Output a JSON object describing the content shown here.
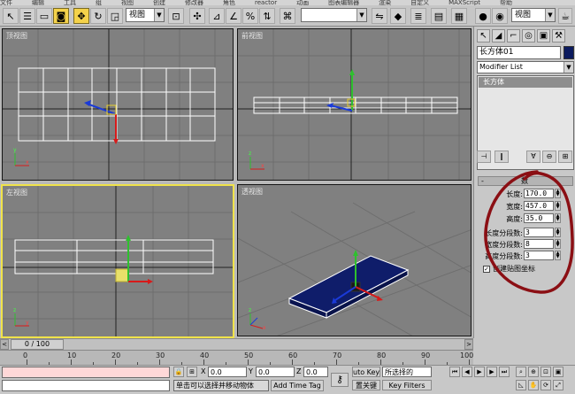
{
  "menu": [
    "文件",
    "编辑",
    "工具",
    "组",
    "视图",
    "创建",
    "修改器",
    "角色",
    "reactor",
    "动画",
    "图表编辑器",
    "渲染",
    "自定义",
    "MAXScript",
    "帮助"
  ],
  "toolbar": {
    "refcoord_value": "视图",
    "named_selection_value": "",
    "view_combo_value": "视图"
  },
  "viewports": {
    "top": {
      "label": "顶视图"
    },
    "front": {
      "label": "前视图"
    },
    "left": {
      "label": "左视图"
    },
    "perspective": {
      "label": "透视图"
    }
  },
  "axis_labels": {
    "x": "x",
    "y": "y",
    "z": "z"
  },
  "command_panel": {
    "object_name": "长方体01",
    "object_color": "#0b1a5e",
    "modifier_list": "Modifier List",
    "stack_item": "长方体",
    "params_title": "数",
    "params": [
      {
        "label": "长度:",
        "value": "170.0"
      },
      {
        "label": "宽度:",
        "value": "457.0"
      },
      {
        "label": "高度:",
        "value": "35.0"
      },
      {
        "label": "长度分段数:",
        "value": "3"
      },
      {
        "label": "宽度分段数:",
        "value": "8"
      },
      {
        "label": "高度分段数:",
        "value": "3"
      }
    ],
    "gen_mapping_label": "创建贴图坐标",
    "gen_mapping_checked": "✓"
  },
  "timeline": {
    "frame_display": "0 / 100",
    "ticks": [
      "0",
      "10",
      "20",
      "30",
      "40",
      "50",
      "60",
      "70",
      "80",
      "90",
      "100"
    ]
  },
  "status": {
    "x_label": "X",
    "x_value": "0.0",
    "y_label": "Y",
    "y_value": "0.0",
    "z_label": "Z",
    "z_value": "0.0",
    "auto_key": "uto Key",
    "selection_filter": "所选择的",
    "set_key": "置关键",
    "key_filters": "Key Filters",
    "prompt": "单击可以选择并移动物体",
    "add_time_tag": "Add Time Tag"
  },
  "colors": {
    "viewport_bg": "#808080",
    "active_border": "#f0e34a",
    "box_fill": "#0f1d6a",
    "wire": "#ffffff",
    "annotation": "#8b0f14"
  }
}
